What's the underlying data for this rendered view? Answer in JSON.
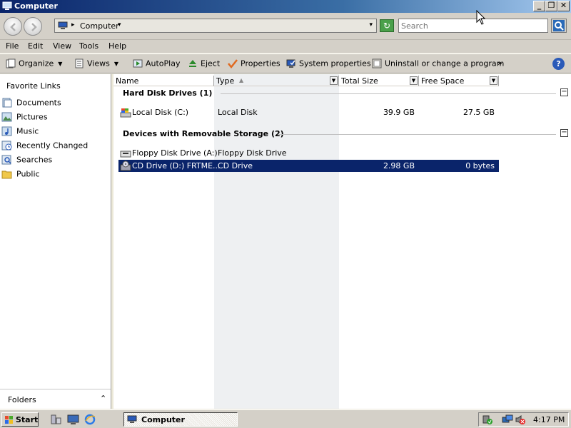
{
  "window": {
    "title": "Computer",
    "buttons": {
      "minimize": "_",
      "maximize": "❐",
      "close": "✕"
    }
  },
  "address": {
    "crumb": "Computer",
    "separator": "▸",
    "crumb_arrow": "▾",
    "dropdown": "▾"
  },
  "search": {
    "placeholder": "Search"
  },
  "menu": [
    "File",
    "Edit",
    "View",
    "Tools",
    "Help"
  ],
  "toolbar": {
    "organize": "Organize",
    "views": "Views",
    "autoplay": "AutoPlay",
    "eject": "Eject",
    "properties": "Properties",
    "system_properties": "System properties",
    "uninstall": "Uninstall or change a program",
    "more": "»",
    "help": "?"
  },
  "favorites": {
    "title": "Favorite Links",
    "items": [
      "Documents",
      "Pictures",
      "Music",
      "Recently Changed",
      "Searches",
      "Public"
    ]
  },
  "folders_bar": {
    "label": "Folders",
    "chevron": "⌃"
  },
  "columns": [
    "Name",
    "Type",
    "Total Size",
    "Free Space"
  ],
  "groups": [
    {
      "title": "Hard Disk Drives (1)",
      "items": [
        {
          "name": "Local Disk (C:)",
          "type": "Local Disk",
          "total": "39.9 GB",
          "free": "27.5 GB"
        }
      ]
    },
    {
      "title": "Devices with Removable Storage (2)",
      "items": [
        {
          "name": "Floppy Disk Drive (A:)",
          "type": "Floppy Disk Drive",
          "total": "",
          "free": ""
        },
        {
          "name": "CD Drive (D:) FRTME...",
          "type": "CD Drive",
          "total": "2.98 GB",
          "free": "0 bytes"
        }
      ]
    }
  ],
  "taskbar": {
    "start": "Start",
    "task": "Computer",
    "clock": "4:17 PM"
  },
  "colors": {
    "selection": "#0a246a",
    "title_start": "#0a246a",
    "title_end": "#a6caf0"
  }
}
